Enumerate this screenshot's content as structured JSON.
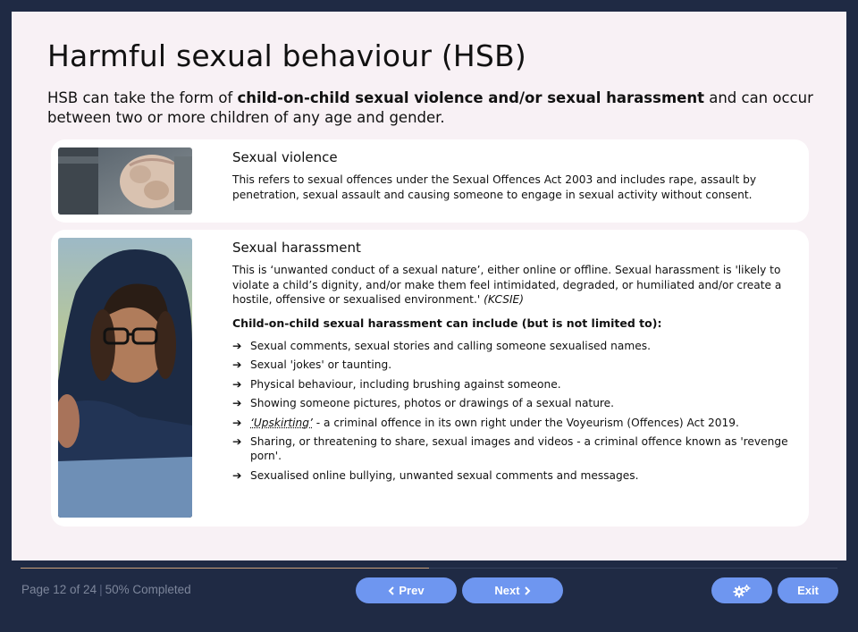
{
  "slide": {
    "title": "Harmful sexual behaviour (HSB)",
    "intro": {
      "pre": "HSB can take the form of ",
      "bold": "child-on-child sexual violence and/or sexual harassment",
      "post": " and can occur between two or more children of any age and gender."
    },
    "card_violence": {
      "heading": "Sexual violence",
      "text": "This refers to sexual offences under the Sexual Offences Act 2003 and includes rape, assault by penetration, sexual assault and causing someone to engage in sexual activity without consent.",
      "image_icon": "clenched-fist-photo"
    },
    "card_harassment": {
      "heading": "Sexual harassment",
      "text": "This is ‘unwanted conduct of a sexual nature’, either online or offline. Sexual harassment is 'likely to violate a child’s dignity, and/or make them feel intimidated, degraded, or humiliated and/or create a hostile, offensive or sexualised environment.' ",
      "text_italic": "(KCSIE)",
      "subheading": "Child-on-child sexual harassment can include (but is not limited to):",
      "image_icon": "girl-in-hoodie-photo",
      "bullets": [
        {
          "text": "Sexual comments, sexual stories and calling someone sexualised names."
        },
        {
          "text": "Sexual 'jokes' or taunting."
        },
        {
          "text": "Physical behaviour, including brushing against someone."
        },
        {
          "text": "Showing someone pictures, photos or drawings of a sexual nature."
        },
        {
          "emph": "‘Upskirting’",
          "text": " - a criminal offence in its own right under the Voyeurism (Offences) Act 2019."
        },
        {
          "text": "Sharing, or threatening to share, sexual images and videos - a criminal offence known as 'revenge porn'."
        },
        {
          "text": "Sexualised online bullying, unwanted sexual comments and messages."
        }
      ],
      "bullet_icon": "arrow-right-icon"
    }
  },
  "footer": {
    "page_label": "Page 12 of 24",
    "separator": "|",
    "completed_label": "50% Completed",
    "progress_percent": 50,
    "prev_label": "Prev",
    "next_label": "Next",
    "exit_label": "Exit",
    "settings_icon": "gears-icon"
  },
  "colors": {
    "background": "#1f2a44",
    "slide": "#f8f1f5",
    "button": "#6e96f0",
    "progress": "#c9a07a"
  }
}
